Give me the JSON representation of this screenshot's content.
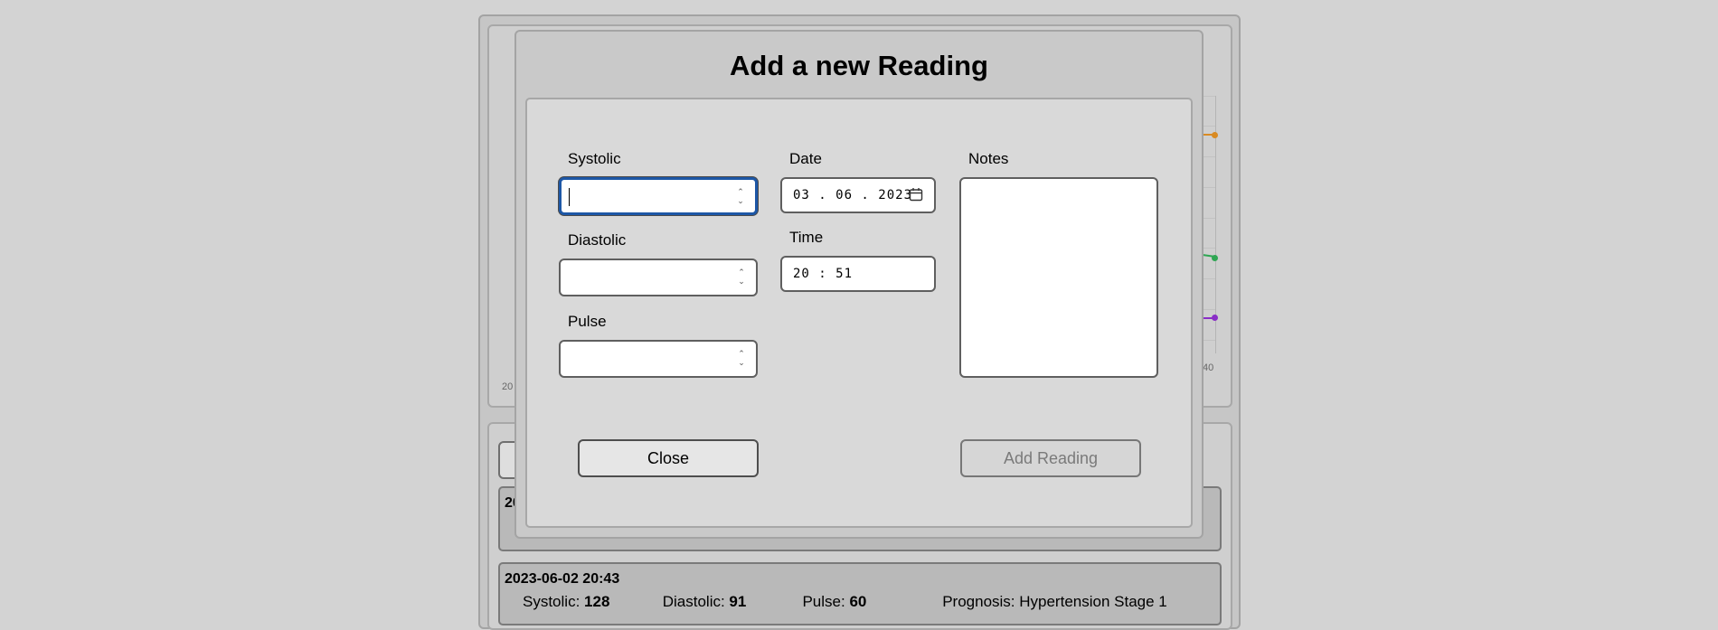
{
  "background": {
    "chart": {
      "tick_left": "20",
      "tick_right": "40",
      "series_colors": {
        "systolic": "#d98a22",
        "diastolic": "#2fa653",
        "pulse": "#8a2ec7"
      }
    },
    "list": {
      "partial_card_date": "20",
      "card": {
        "date": "2023-06-02 20:43",
        "systolic_label": "Systolic: ",
        "systolic_value": "128",
        "diastolic_label": "Diastolic: ",
        "diastolic_value": "91",
        "pulse_label": "Pulse: ",
        "pulse_value": "60",
        "prognosis_label": "Prognosis: ",
        "prognosis_value": "Hypertension Stage 1"
      }
    }
  },
  "modal": {
    "title": "Add a new Reading",
    "fields": {
      "systolic": {
        "label": "Systolic",
        "value": ""
      },
      "diastolic": {
        "label": "Diastolic",
        "value": ""
      },
      "pulse": {
        "label": "Pulse",
        "value": ""
      },
      "date": {
        "label": "Date",
        "value": "03 . 06 . 2023"
      },
      "time": {
        "label": "Time",
        "value": "20 : 51"
      },
      "notes": {
        "label": "Notes",
        "value": ""
      }
    },
    "buttons": {
      "close": "Close",
      "add": "Add Reading"
    }
  }
}
